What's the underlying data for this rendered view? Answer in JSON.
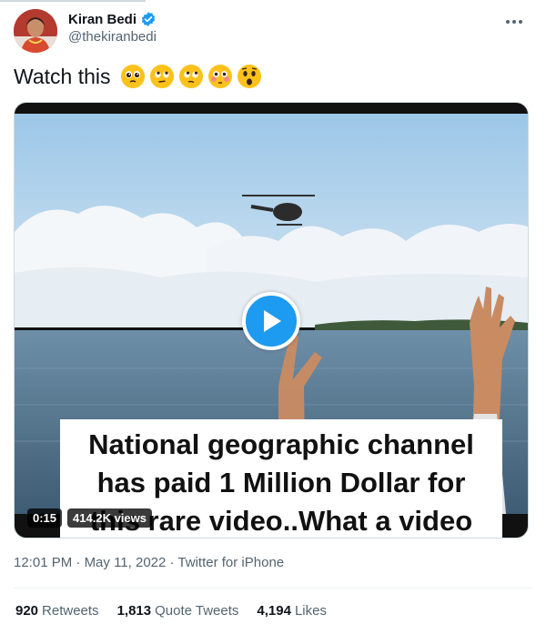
{
  "author": {
    "display_name": "Kiran Bedi",
    "handle": "@thekiranbedi"
  },
  "icons": {
    "verified": "verified-badge-icon",
    "more": "more-options-icon",
    "play": "play-icon"
  },
  "tweet": {
    "text": "Watch this",
    "emojis": [
      "pleading-face",
      "face-with-rolling-eyes",
      "face-with-rolling-eyes",
      "flushed-face",
      "astonished-face"
    ]
  },
  "media": {
    "caption_lines": [
      "National geographic channel",
      "has paid 1 Million Dollar for",
      "this rare  video..What a video"
    ],
    "duration": "0:15",
    "views": "414.2K views"
  },
  "meta": {
    "time": "12:01 PM",
    "separator": "·",
    "date": "May 11, 2022",
    "source": "Twitter for iPhone"
  },
  "stats": {
    "retweets_count": "920",
    "retweets_label": "Retweets",
    "quotes_count": "1,813",
    "quotes_label": "Quote Tweets",
    "likes_count": "4,194",
    "likes_label": "Likes"
  },
  "colors": {
    "accent": "#1d9bf0",
    "secondary_text": "#536471",
    "primary_text": "#0f1419"
  }
}
